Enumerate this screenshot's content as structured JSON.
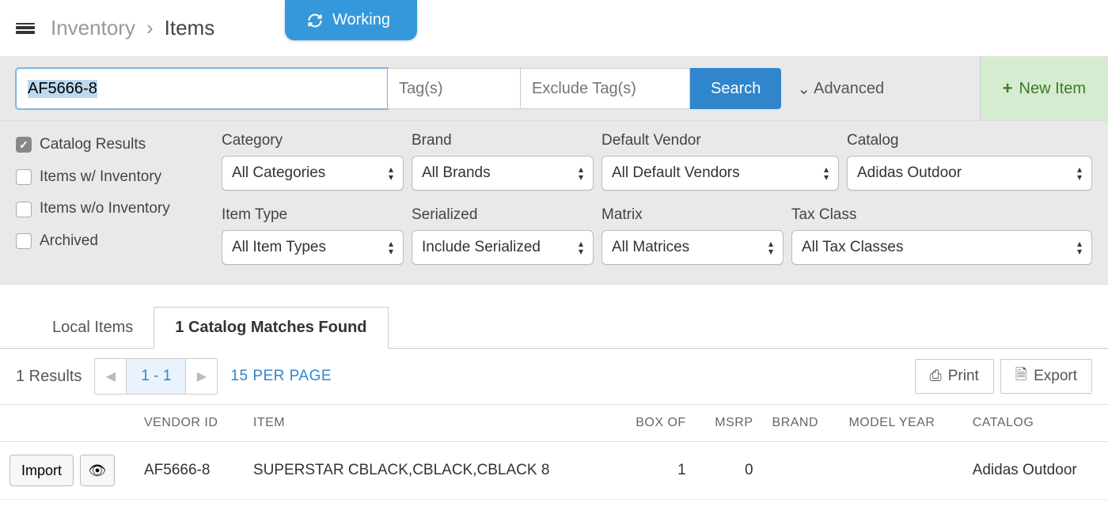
{
  "breadcrumb": {
    "parent": "Inventory",
    "current": "Items"
  },
  "status_pill": "Working",
  "search": {
    "value": "AF5666-8",
    "tags_placeholder": "Tag(s)",
    "exclude_tags_placeholder": "Exclude Tag(s)",
    "button": "Search",
    "advanced_label": "Advanced",
    "new_item_label": "New Item"
  },
  "checkboxes": {
    "catalog_results": {
      "label": "Catalog Results",
      "checked": true
    },
    "items_w_inv": {
      "label": "Items w/ Inventory",
      "checked": false
    },
    "items_wo_inv": {
      "label": "Items w/o Inventory",
      "checked": false
    },
    "archived": {
      "label": "Archived",
      "checked": false
    }
  },
  "filters_row1": {
    "category": {
      "label": "Category",
      "value": "All Categories"
    },
    "brand": {
      "label": "Brand",
      "value": "All Brands"
    },
    "default_vendor": {
      "label": "Default Vendor",
      "value": "All Default Vendors"
    },
    "catalog": {
      "label": "Catalog",
      "value": "Adidas Outdoor"
    }
  },
  "filters_row2": {
    "item_type": {
      "label": "Item Type",
      "value": "All Item Types"
    },
    "serialized": {
      "label": "Serialized",
      "value": "Include Serialized"
    },
    "matrix": {
      "label": "Matrix",
      "value": "All Matrices"
    },
    "tax_class": {
      "label": "Tax Class",
      "value": "All Tax Classes"
    }
  },
  "tabs": {
    "local": "Local Items",
    "catalog_matches": "1 Catalog Matches Found"
  },
  "results": {
    "count_text": "1 Results",
    "page_range": "1 - 1",
    "per_page": "15 PER PAGE",
    "print": "Print",
    "export": "Export"
  },
  "table": {
    "headers": {
      "vendor_id": "VENDOR ID",
      "item": "ITEM",
      "box_of": "BOX OF",
      "msrp": "MSRP",
      "brand": "BRAND",
      "model_year": "MODEL YEAR",
      "catalog": "CATALOG"
    },
    "row": {
      "import": "Import",
      "vendor_id": "AF5666-8",
      "item": "SUPERSTAR CBLACK,CBLACK,CBLACK 8",
      "box_of": "1",
      "msrp": "0",
      "brand": "",
      "model_year": "",
      "catalog": "Adidas Outdoor"
    }
  }
}
